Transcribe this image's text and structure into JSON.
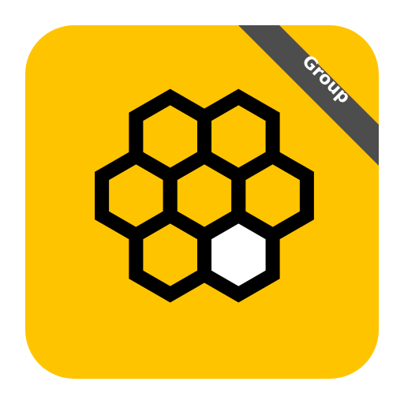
{
  "app_icon": {
    "badge_label": "Group",
    "icon_name": "honeycomb-icon",
    "colors": {
      "tile": "#FFC400",
      "outline": "#000000",
      "cell_fill": "#FFC400",
      "highlight_cell": "#FFFFFF",
      "ribbon": "#4D4D4D",
      "ribbon_text": "#FFFFFF"
    },
    "honeycomb": {
      "cell_count": 7,
      "highlighted_cell": "bottom-right"
    }
  }
}
